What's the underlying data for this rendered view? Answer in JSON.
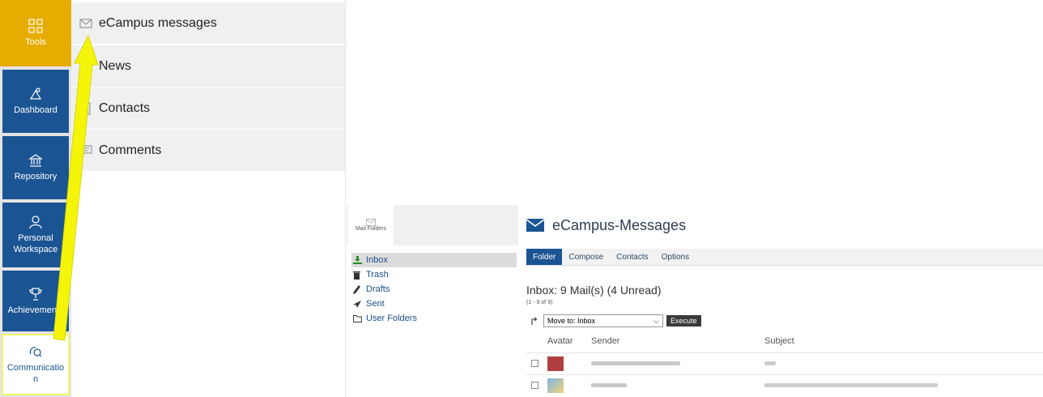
{
  "mainbar": {
    "items": [
      {
        "label": "Tools",
        "icon": "tools-grid-icon"
      },
      {
        "label": "Dashboard",
        "icon": "dashboard-icon"
      },
      {
        "label": "Repository",
        "icon": "repository-icon"
      },
      {
        "label": "Personal Workspace",
        "icon": "personal-workspace-icon"
      },
      {
        "label": "Achievements",
        "icon": "trophy-icon"
      },
      {
        "label": "Communication",
        "icon": "communication-icon"
      }
    ]
  },
  "slate": {
    "items": [
      {
        "label": "eCampus messages",
        "icon": "envelope-icon"
      },
      {
        "label": "News",
        "icon": "news-icon"
      },
      {
        "label": "Contacts",
        "icon": "contacts-icon"
      },
      {
        "label": "Comments",
        "icon": "comments-icon"
      }
    ]
  },
  "mail": {
    "tab_label": "Mail Folders",
    "title": "eCampus-Messages",
    "tabs": [
      "Folder",
      "Compose",
      "Contacts",
      "Options"
    ],
    "folders": [
      "Inbox",
      "Trash",
      "Drafts",
      "Sent",
      "User Folders"
    ],
    "summary": "Inbox: 9 Mail(s) (4 Unread)",
    "range": "(1 - 9 of 9)",
    "move_to": "Move to: Inbox",
    "execute": "Execute",
    "columns": {
      "avatar": "Avatar",
      "sender": "Sender",
      "subject": "Subject"
    }
  },
  "colors": {
    "mainbar_blue": "#1b5493",
    "tools_active": "#e7ac00",
    "arrow_yellow": "#f5f50a",
    "highlight_border": "#f3f56c"
  }
}
